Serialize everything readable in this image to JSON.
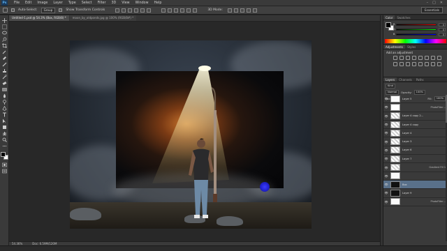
{
  "app": {
    "logo": "Ps"
  },
  "menu": [
    "File",
    "Edit",
    "Image",
    "Layer",
    "Type",
    "Select",
    "Filter",
    "3D",
    "View",
    "Window",
    "Help"
  ],
  "window_controls": [
    "–",
    "□",
    "✕"
  ],
  "options": {
    "auto_select_label": "Auto-Select:",
    "auto_select_value": "Group",
    "transform_label": "Show Transform Controls",
    "mode_label": "3D Mode:",
    "workspace": "Essentials"
  },
  "tabs": [
    {
      "label": "Untitled-1.psd @ 54.3% (Box, RGB/8) *"
    },
    {
      "label": "moon_by_oldponds.jpg @ 100% (RGB/8#) *"
    }
  ],
  "status": {
    "zoom": "54.36%",
    "doc": "Doc: 6.59M/120M"
  },
  "color_panel": {
    "tabs": [
      "Color",
      "Swatches"
    ],
    "sliders": [
      {
        "label": "R",
        "value": "0",
        "colors": [
          "#000",
          "#f00"
        ]
      },
      {
        "label": "G",
        "value": "0",
        "colors": [
          "#000",
          "#0f0"
        ]
      },
      {
        "label": "B",
        "value": "0",
        "colors": [
          "#000",
          "#00f"
        ]
      }
    ]
  },
  "adjustments_panel": {
    "tabs": [
      "Adjustments",
      "Styles"
    ],
    "title": "Add an adjustment"
  },
  "layers_panel": {
    "tabs": [
      "Layers",
      "Channels",
      "Paths"
    ],
    "kind": "Kind",
    "blend": "Normal",
    "opacity_label": "Opacity:",
    "opacity": "100%",
    "lock_label": "Lock:",
    "fill_label": "Fill:",
    "fill": "100%",
    "layers": [
      {
        "name": "Layer 5",
        "thumb": "white",
        "fx": "",
        "selected": false
      },
      {
        "name": "",
        "thumb": "mask",
        "fx": "PhotoFilter…",
        "selected": false
      },
      {
        "name": "Layer 4 copy 2…",
        "thumb": "checker",
        "fx": "",
        "selected": false
      },
      {
        "name": "Layer 4 copy",
        "thumb": "checker",
        "fx": "",
        "selected": false
      },
      {
        "name": "Layer 4",
        "thumb": "checker",
        "fx": "",
        "selected": false
      },
      {
        "name": "Layer 3",
        "thumb": "checker",
        "fx": "",
        "selected": false
      },
      {
        "name": "Layer 6",
        "thumb": "checker",
        "fx": "",
        "selected": false
      },
      {
        "name": "Layer 7",
        "thumb": "checker",
        "fx": "",
        "selected": false
      },
      {
        "name": "",
        "thumb": "checker",
        "fx": "Gradient Fill 1",
        "selected": false
      },
      {
        "name": "",
        "thumb": "white",
        "fx": "",
        "selected": false
      },
      {
        "name": "Box",
        "thumb": "dark",
        "fx": "",
        "selected": true
      },
      {
        "name": "Layer 9",
        "thumb": "dark",
        "fx": "",
        "selected": false
      },
      {
        "name": "",
        "thumb": "white",
        "fx": "PhotoFilter…",
        "selected": false
      }
    ]
  }
}
